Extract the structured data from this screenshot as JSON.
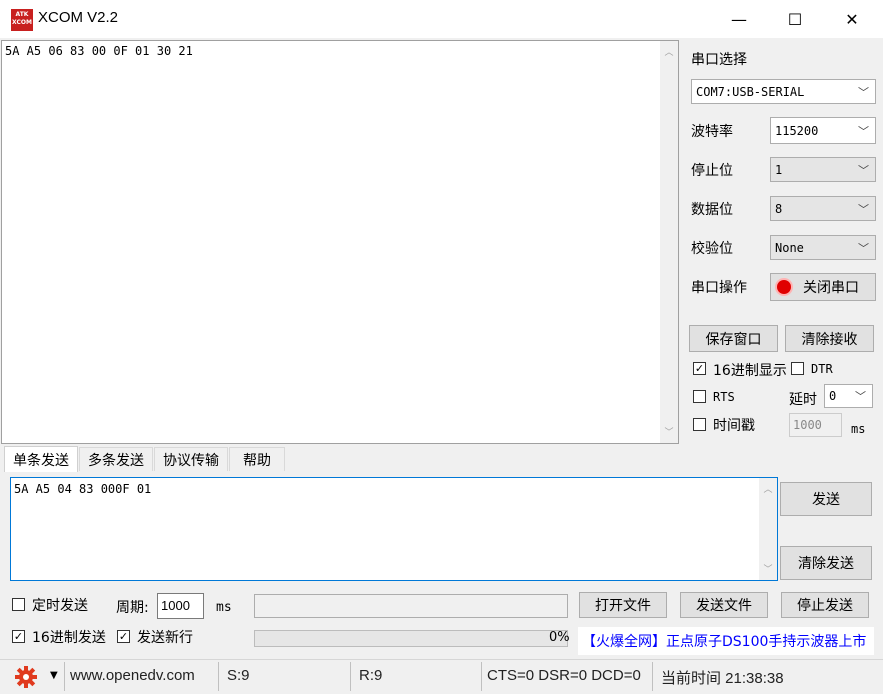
{
  "window": {
    "title": "XCOM V2.2",
    "logo_text": "ATK XCOM",
    "minimize": "—",
    "maximize": "☐",
    "close": "✕"
  },
  "receive": {
    "text": "5A A5 06 83 00 0F 01 30 21"
  },
  "serial": {
    "port_label": "串口选择",
    "port_value": "COM7:USB-SERIAL",
    "baud_label": "波特率",
    "baud_value": "115200",
    "stop_label": "停止位",
    "stop_value": "1",
    "data_label": "数据位",
    "data_value": "8",
    "parity_label": "校验位",
    "parity_value": "None",
    "op_label": "串口操作",
    "op_button": "关闭串口",
    "save_button": "保存窗口",
    "clear_recv_button": "清除接收",
    "hex_display_label": "16进制显示",
    "hex_display_checked": true,
    "dtr_label": "DTR",
    "rts_label": "RTS",
    "delay_label": "延时",
    "delay_value": "0",
    "timestamp_label": "时间戳",
    "timestamp_value": "1000",
    "timestamp_unit": "ms"
  },
  "tabs": [
    "单条发送",
    "多条发送",
    "协议传输",
    "帮助"
  ],
  "send": {
    "text": "5A A5 04 83 000F 01",
    "send_button": "发送",
    "clear_send_button": "清除发送",
    "timed_send_label": "定时发送",
    "period_label": "周期:",
    "period_value": "1000",
    "period_unit": "ms",
    "open_file_button": "打开文件",
    "send_file_button": "发送文件",
    "stop_send_button": "停止发送",
    "hex_send_label": "16进制发送",
    "newline_label": "发送新行",
    "progress_text": "0%",
    "progress": 0,
    "ad_text": "【火爆全网】正点原子DS100手持示波器上市"
  },
  "status": {
    "website": "www.openedv.com",
    "sent": "S:9",
    "received": "R:9",
    "signals": "CTS=0 DSR=0 DCD=0",
    "time": "当前时间 21:38:38"
  },
  "colors": {
    "accent": "#0078d7",
    "ad_text": "#0000ff",
    "gear": "#e03a1e",
    "led": "#e00000"
  }
}
